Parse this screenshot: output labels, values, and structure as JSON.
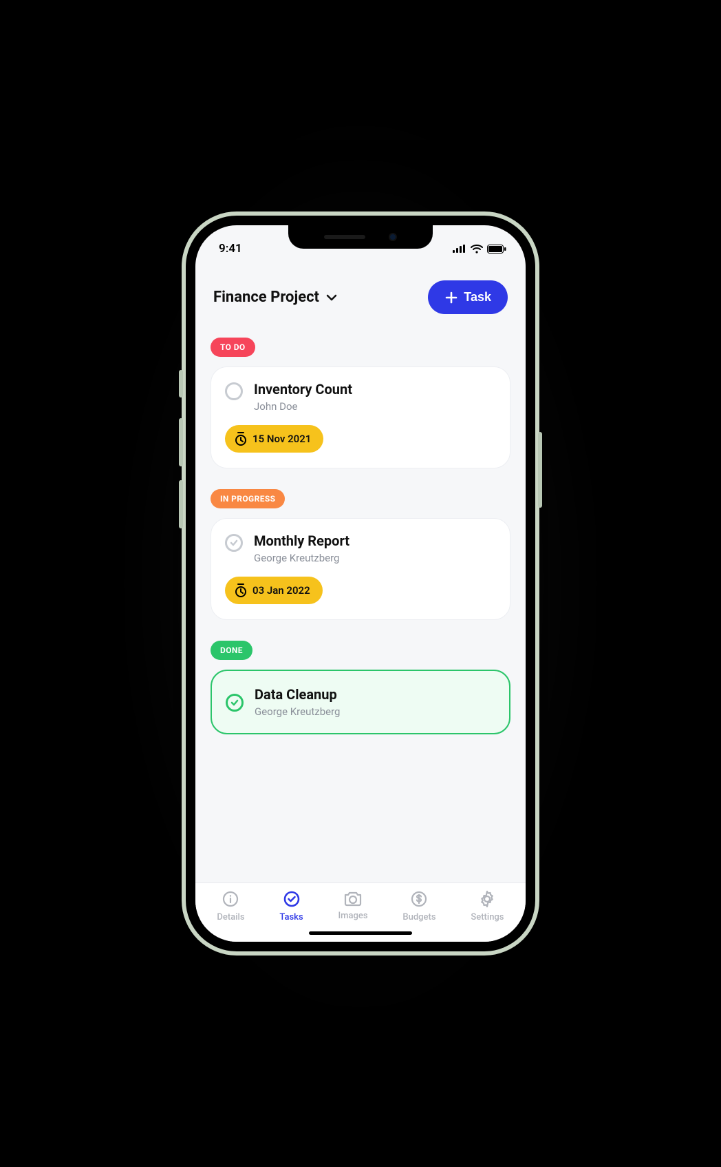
{
  "status_bar": {
    "time": "9:41"
  },
  "header": {
    "project_name": "Finance Project",
    "add_task_label": "Task"
  },
  "sections": {
    "todo": {
      "label": "TO DO",
      "task": {
        "title": "Inventory Count",
        "assignee": "John Doe",
        "due": "15 Nov 2021"
      }
    },
    "in_progress": {
      "label": "IN PROGRESS",
      "task": {
        "title": "Monthly Report",
        "assignee": "George Kreutzberg",
        "due": "03 Jan 2022"
      }
    },
    "done": {
      "label": "DONE",
      "task": {
        "title": "Data Cleanup",
        "assignee": "George Kreutzberg"
      }
    }
  },
  "tabs": {
    "details": "Details",
    "tasks": "Tasks",
    "images": "Images",
    "budgets": "Budgets",
    "settings": "Settings"
  },
  "colors": {
    "accent": "#2f39e6",
    "todo": "#f6455a",
    "progress": "#f98843",
    "done": "#2bc56a",
    "date_chip": "#f6c21c"
  }
}
